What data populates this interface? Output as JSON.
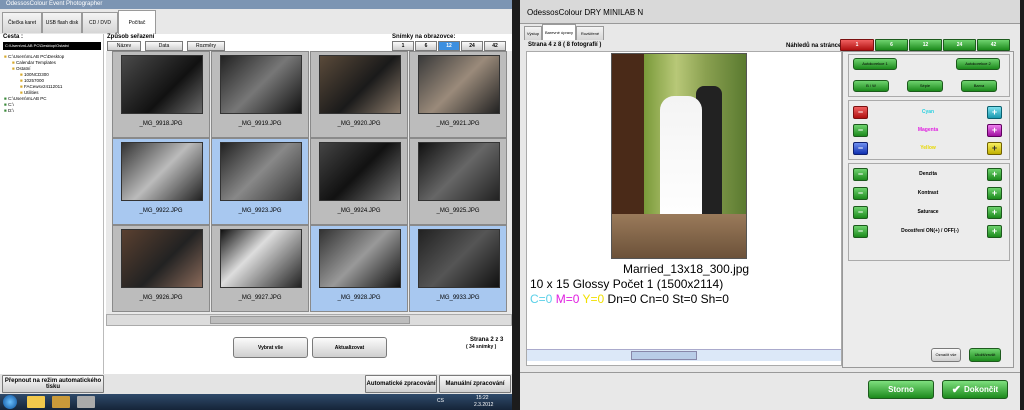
{
  "left": {
    "title": "OdessosColour Event Photographer",
    "tabs": [
      "Čtečka karet",
      "USB flash disk",
      "CD / DVD",
      "Počítač"
    ],
    "path_label": "Cesta :",
    "path_value": "C:\\Users\\mLAB PC\\Desktop\\Ostatni",
    "tree": [
      "C:\\Users\\mLAB PC\\Desktop",
      "Calendar Templates",
      "Ostatní",
      "100NCD300",
      "10257000",
      "FACewsv24112011",
      "Utilities",
      "C:\\Users\\mLAB PC",
      "C:\\",
      "D:\\"
    ],
    "sort_label": "Způsob seřazení",
    "sort_buttons": [
      "Název",
      "Data",
      "Rozměry"
    ],
    "per_screen_label": "Snímky na obrazovce:",
    "per_screen": [
      "1",
      "6",
      "12",
      "24",
      "42"
    ],
    "thumbs": [
      "_MG_9918.JPG",
      "_MG_9919.JPG",
      "_MG_9920.JPG",
      "_MG_9921.JPG",
      "_MG_9922.JPG",
      "_MG_9923.JPG",
      "_MG_9924.JPG",
      "_MG_9925.JPG",
      "_MG_9926.JPG",
      "_MG_9927.JPG",
      "_MG_9928.JPG",
      "_MG_9933.JPG"
    ],
    "select_all": "Vybrat vše",
    "refresh": "Aktualizovat",
    "page_info": "Strana 2 z 3",
    "page_count": "( 34 snímky )",
    "mode_switch": "Přepnout na režim automatického tisku",
    "auto_process": "Automatické zpracování",
    "manual_process": "Manuální zpracování",
    "lang": "CS",
    "time": "15:22",
    "date": "2.3.2012"
  },
  "right": {
    "title": "OdessosColour DRY MINILAB N",
    "tabs": [
      "Výstup",
      "Barevné úpravy",
      "Rozšířené"
    ],
    "page_info": "Strana 4 z 8 ( 8 fotografií )",
    "preview_label": "Náhledů na stránce:",
    "preview_counts": [
      "1",
      "6",
      "12",
      "24",
      "42"
    ],
    "filename": "Married_13x18_300.jpg",
    "print_info": "10 x 15 Glossy Počet 1 (1500x2114)",
    "corr": [
      "C=0",
      "M=0",
      "Y=0"
    ],
    "corr_rest": "Dn=0 Cn=0 St=0 Sh=0",
    "auto1": "Autokorekce 1",
    "auto2": "Autokorekce 2",
    "bw": "B / W",
    "sepia": "Sépie",
    "color": "Barva",
    "cyan": "Cyan",
    "magenta": "Magenta",
    "yellow": "Yellow",
    "density": "Denzita",
    "contrast": "Kontrast",
    "saturation": "Saturace",
    "sharpen": "Doostření ON(+) / OFF(-)",
    "apply_all": "Označit vše",
    "apply": "Uložit/zrušit",
    "cancel": "Storno",
    "finish": "Dokončit"
  }
}
